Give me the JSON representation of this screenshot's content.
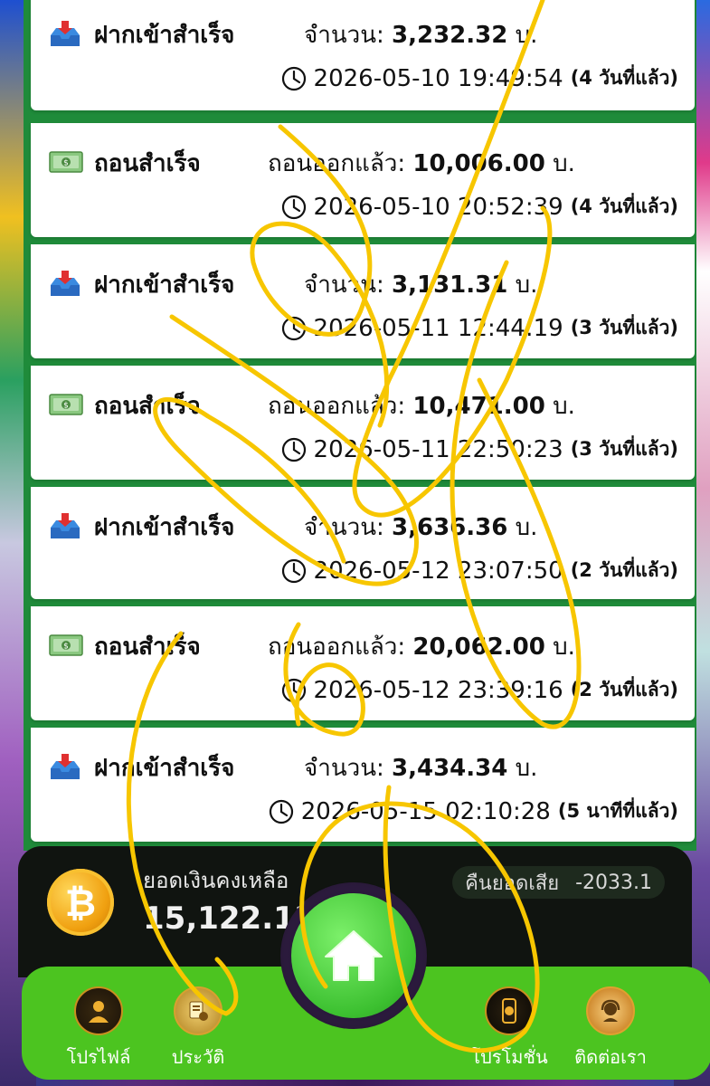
{
  "transactions": [
    {
      "type": "deposit",
      "icon": "inbox-tray-icon",
      "label": "ฝากเข้าสำเร็จ",
      "amount_label": "จำนวน:",
      "amount": "3,232.32",
      "unit": "บ.",
      "datetime": "2026-05-10 19:49:54",
      "ago": "(4 วันที่แล้ว)"
    },
    {
      "type": "withdraw",
      "icon": "money-bill-icon",
      "label": "ถอนสำเร็จ",
      "amount_label": "ถอนออกแล้ว:",
      "amount": "10,006.00",
      "unit": "บ.",
      "datetime": "2026-05-10 20:52:39",
      "ago": "(4 วันที่แล้ว)"
    },
    {
      "type": "deposit",
      "icon": "inbox-tray-icon",
      "label": "ฝากเข้าสำเร็จ",
      "amount_label": "จำนวน:",
      "amount": "3,131.31",
      "unit": "บ.",
      "datetime": "2026-05-11 12:44:19",
      "ago": "(3 วันที่แล้ว)"
    },
    {
      "type": "withdraw",
      "icon": "money-bill-icon",
      "label": "ถอนสำเร็จ",
      "amount_label": "ถอนออกแล้ว:",
      "amount": "10,471.00",
      "unit": "บ.",
      "datetime": "2026-05-11 22:50:23",
      "ago": "(3 วันที่แล้ว)"
    },
    {
      "type": "deposit",
      "icon": "inbox-tray-icon",
      "label": "ฝากเข้าสำเร็จ",
      "amount_label": "จำนวน:",
      "amount": "3,636.36",
      "unit": "บ.",
      "datetime": "2026-05-12 23:07:50",
      "ago": "(2 วันที่แล้ว)"
    },
    {
      "type": "withdraw",
      "icon": "money-bill-icon",
      "label": "ถอนสำเร็จ",
      "amount_label": "ถอนออกแล้ว:",
      "amount": "20,062.00",
      "unit": "บ.",
      "datetime": "2026-05-12 23:39:16",
      "ago": "(2 วันที่แล้ว)"
    },
    {
      "type": "deposit",
      "icon": "inbox-tray-icon",
      "label": "ฝากเข้าสำเร็จ",
      "amount_label": "จำนวน:",
      "amount": "3,434.34",
      "unit": "บ.",
      "datetime": "2026-05-15 02:10:28",
      "ago": "(5 นาทีที่แล้ว)"
    }
  ],
  "balance": {
    "label": "ยอดเงินคงเหลือ",
    "value": "15,122.12",
    "coin_icon": "bitcoin-coin-icon",
    "cashback_label": "คืนยอดเสีย",
    "cashback_value": "-2033.1"
  },
  "nav": {
    "profile": "โปรไฟล์",
    "history": "ประวัติ",
    "home_icon": "home-icon",
    "promotion": "โปรโมชั่น",
    "contact": "ติดต่อเรา"
  },
  "colors": {
    "panel_green": "#1f8b3a",
    "nav_green": "#4cc420",
    "home_green": "#3cc030",
    "scribble_yellow": "#f7c600"
  }
}
